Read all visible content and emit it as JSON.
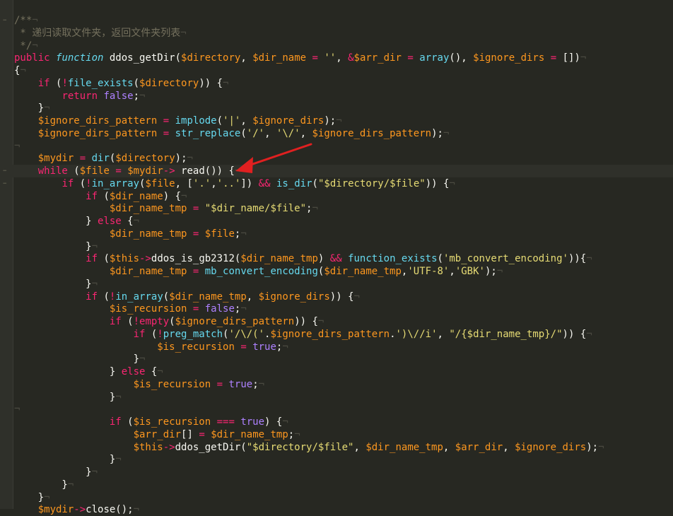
{
  "editor": {
    "theme_colors": {
      "background": "#272822",
      "comment": "#75715e",
      "keyword": "#f92672",
      "function": "#a6e22e",
      "builtin": "#66d9ef",
      "variable": "#fd971f",
      "string": "#e6db74",
      "constant": "#ae81ff",
      "arrow_annotation": "#e02020"
    },
    "lines": [
      {
        "t": [
          [
            "cm",
            "/**"
          ]
        ]
      },
      {
        "t": [
          [
            "cm",
            " * 递归读取文件夹，返回文件夹列表"
          ]
        ]
      },
      {
        "t": [
          [
            "cm",
            " */"
          ]
        ]
      },
      {
        "t": [
          [
            "kw",
            "public"
          ],
          [
            "tx",
            " "
          ],
          [
            "st",
            "function"
          ],
          [
            "tx",
            " ddos_getDir("
          ],
          [
            "vr",
            "$directory"
          ],
          [
            "tx",
            ", "
          ],
          [
            "vr",
            "$dir_name"
          ],
          [
            "tx",
            " "
          ],
          [
            "op",
            "="
          ],
          [
            "tx",
            " "
          ],
          [
            "str",
            "''"
          ],
          [
            "tx",
            ", "
          ],
          [
            "op",
            "&"
          ],
          [
            "vr",
            "$arr_dir"
          ],
          [
            "tx",
            " "
          ],
          [
            "op",
            "="
          ],
          [
            "tx",
            " "
          ],
          [
            "bi",
            "array"
          ],
          [
            "tx",
            "(), "
          ],
          [
            "vr",
            "$ignore_dirs"
          ],
          [
            "tx",
            " "
          ],
          [
            "op",
            "="
          ],
          [
            "tx",
            " [])"
          ]
        ]
      },
      {
        "t": [
          [
            "tx",
            "{"
          ]
        ]
      },
      {
        "t": [
          [
            "tx",
            "    "
          ],
          [
            "kw",
            "if"
          ],
          [
            "tx",
            " ("
          ],
          [
            "op",
            "!"
          ],
          [
            "bi",
            "file_exists"
          ],
          [
            "tx",
            "("
          ],
          [
            "vr",
            "$directory"
          ],
          [
            "tx",
            ")) {"
          ]
        ]
      },
      {
        "t": [
          [
            "tx",
            "        "
          ],
          [
            "kw",
            "return"
          ],
          [
            "tx",
            " "
          ],
          [
            "cn",
            "false"
          ],
          [
            "tx",
            ";"
          ]
        ]
      },
      {
        "t": [
          [
            "tx",
            "    }"
          ]
        ]
      },
      {
        "t": [
          [
            "tx",
            "    "
          ],
          [
            "vr",
            "$ignore_dirs_pattern"
          ],
          [
            "tx",
            " "
          ],
          [
            "op",
            "="
          ],
          [
            "tx",
            " "
          ],
          [
            "bi",
            "implode"
          ],
          [
            "tx",
            "("
          ],
          [
            "str",
            "'|'"
          ],
          [
            "tx",
            ", "
          ],
          [
            "vr",
            "$ignore_dirs"
          ],
          [
            "tx",
            ");"
          ]
        ]
      },
      {
        "t": [
          [
            "tx",
            "    "
          ],
          [
            "vr",
            "$ignore_dirs_pattern"
          ],
          [
            "tx",
            " "
          ],
          [
            "op",
            "="
          ],
          [
            "tx",
            " "
          ],
          [
            "bi",
            "str_replace"
          ],
          [
            "tx",
            "("
          ],
          [
            "str",
            "'/'"
          ],
          [
            "tx",
            ", "
          ],
          [
            "str",
            "'\\/'"
          ],
          [
            "tx",
            ", "
          ],
          [
            "vr",
            "$ignore_dirs_pattern"
          ],
          [
            "tx",
            ");"
          ]
        ]
      },
      {
        "t": []
      },
      {
        "t": [
          [
            "tx",
            "    "
          ],
          [
            "vr",
            "$mydir"
          ],
          [
            "tx",
            " "
          ],
          [
            "op",
            "="
          ],
          [
            "tx",
            " "
          ],
          [
            "bi",
            "dir"
          ],
          [
            "tx",
            "("
          ],
          [
            "vr",
            "$directory"
          ],
          [
            "tx",
            ");"
          ]
        ]
      },
      {
        "t": [
          [
            "tx",
            "    "
          ],
          [
            "kw",
            "while"
          ],
          [
            "tx",
            " ("
          ],
          [
            "vr",
            "$file"
          ],
          [
            "tx",
            " "
          ],
          [
            "op",
            "="
          ],
          [
            "tx",
            " "
          ],
          [
            "vr",
            "$mydir"
          ],
          [
            "op",
            "->"
          ],
          [
            "tx",
            " read()) {"
          ]
        ],
        "current": true
      },
      {
        "t": [
          [
            "tx",
            "        "
          ],
          [
            "kw",
            "if"
          ],
          [
            "tx",
            " ("
          ],
          [
            "op",
            "!"
          ],
          [
            "bi",
            "in_array"
          ],
          [
            "tx",
            "("
          ],
          [
            "vr",
            "$file"
          ],
          [
            "tx",
            ", ["
          ],
          [
            "str",
            "'.'"
          ],
          [
            "tx",
            ","
          ],
          [
            "str",
            "'..'"
          ],
          [
            "tx",
            "]) "
          ],
          [
            "op",
            "&&"
          ],
          [
            "tx",
            " "
          ],
          [
            "bi",
            "is_dir"
          ],
          [
            "tx",
            "("
          ],
          [
            "str",
            "\"$directory/$file\""
          ],
          [
            "tx",
            ")) {"
          ]
        ]
      },
      {
        "t": [
          [
            "tx",
            "            "
          ],
          [
            "kw",
            "if"
          ],
          [
            "tx",
            " ("
          ],
          [
            "vr",
            "$dir_name"
          ],
          [
            "tx",
            ") {"
          ]
        ]
      },
      {
        "t": [
          [
            "tx",
            "                "
          ],
          [
            "vr",
            "$dir_name_tmp"
          ],
          [
            "tx",
            " "
          ],
          [
            "op",
            "="
          ],
          [
            "tx",
            " "
          ],
          [
            "str",
            "\"$dir_name/$file\""
          ],
          [
            "tx",
            ";"
          ]
        ]
      },
      {
        "t": [
          [
            "tx",
            "            } "
          ],
          [
            "kw",
            "else"
          ],
          [
            "tx",
            " {"
          ]
        ]
      },
      {
        "t": [
          [
            "tx",
            "                "
          ],
          [
            "vr",
            "$dir_name_tmp"
          ],
          [
            "tx",
            " "
          ],
          [
            "op",
            "="
          ],
          [
            "tx",
            " "
          ],
          [
            "vr",
            "$file"
          ],
          [
            "tx",
            ";"
          ]
        ]
      },
      {
        "t": [
          [
            "tx",
            "            }"
          ]
        ]
      },
      {
        "t": [
          [
            "tx",
            "            "
          ],
          [
            "kw",
            "if"
          ],
          [
            "tx",
            " ("
          ],
          [
            "vr",
            "$this"
          ],
          [
            "op",
            "->"
          ],
          [
            "tx",
            "ddos_is_gb2312("
          ],
          [
            "vr",
            "$dir_name_tmp"
          ],
          [
            "tx",
            ") "
          ],
          [
            "op",
            "&&"
          ],
          [
            "tx",
            " "
          ],
          [
            "bi",
            "function_exists"
          ],
          [
            "tx",
            "("
          ],
          [
            "str",
            "'mb_convert_encoding'"
          ],
          [
            "tx",
            ")){"
          ]
        ]
      },
      {
        "t": [
          [
            "tx",
            "                "
          ],
          [
            "vr",
            "$dir_name_tmp"
          ],
          [
            "tx",
            " "
          ],
          [
            "op",
            "="
          ],
          [
            "tx",
            " "
          ],
          [
            "bi",
            "mb_convert_encoding"
          ],
          [
            "tx",
            "("
          ],
          [
            "vr",
            "$dir_name_tmp"
          ],
          [
            "tx",
            ","
          ],
          [
            "str",
            "'UTF-8'"
          ],
          [
            "tx",
            ","
          ],
          [
            "str",
            "'GBK'"
          ],
          [
            "tx",
            ");"
          ]
        ]
      },
      {
        "t": [
          [
            "tx",
            "            }"
          ]
        ]
      },
      {
        "t": [
          [
            "tx",
            "            "
          ],
          [
            "kw",
            "if"
          ],
          [
            "tx",
            " ("
          ],
          [
            "op",
            "!"
          ],
          [
            "bi",
            "in_array"
          ],
          [
            "tx",
            "("
          ],
          [
            "vr",
            "$dir_name_tmp"
          ],
          [
            "tx",
            ", "
          ],
          [
            "vr",
            "$ignore_dirs"
          ],
          [
            "tx",
            ")) {"
          ]
        ]
      },
      {
        "t": [
          [
            "tx",
            "                "
          ],
          [
            "vr",
            "$is_recursion"
          ],
          [
            "tx",
            " "
          ],
          [
            "op",
            "="
          ],
          [
            "tx",
            " "
          ],
          [
            "cn",
            "false"
          ],
          [
            "tx",
            ";"
          ]
        ]
      },
      {
        "t": [
          [
            "tx",
            "                "
          ],
          [
            "kw",
            "if"
          ],
          [
            "tx",
            " ("
          ],
          [
            "op",
            "!"
          ],
          [
            "kw",
            "empty"
          ],
          [
            "tx",
            "("
          ],
          [
            "vr",
            "$ignore_dirs_pattern"
          ],
          [
            "tx",
            ")) {"
          ]
        ]
      },
      {
        "t": [
          [
            "tx",
            "                    "
          ],
          [
            "kw",
            "if"
          ],
          [
            "tx",
            " ("
          ],
          [
            "op",
            "!"
          ],
          [
            "bi",
            "preg_match"
          ],
          [
            "tx",
            "("
          ],
          [
            "str",
            "'/\\/('"
          ],
          [
            "tx",
            "."
          ],
          [
            "vr",
            "$ignore_dirs_pattern"
          ],
          [
            "tx",
            "."
          ],
          [
            "str",
            "')\\//i'"
          ],
          [
            "tx",
            ", "
          ],
          [
            "str",
            "\"/{$dir_name_tmp}/\""
          ],
          [
            "tx",
            ")) {"
          ]
        ]
      },
      {
        "t": [
          [
            "tx",
            "                        "
          ],
          [
            "vr",
            "$is_recursion"
          ],
          [
            "tx",
            " "
          ],
          [
            "op",
            "="
          ],
          [
            "tx",
            " "
          ],
          [
            "cn",
            "true"
          ],
          [
            "tx",
            ";"
          ]
        ]
      },
      {
        "t": [
          [
            "tx",
            "                    }"
          ]
        ]
      },
      {
        "t": [
          [
            "tx",
            "                } "
          ],
          [
            "kw",
            "else"
          ],
          [
            "tx",
            " {"
          ]
        ]
      },
      {
        "t": [
          [
            "tx",
            "                    "
          ],
          [
            "vr",
            "$is_recursion"
          ],
          [
            "tx",
            " "
          ],
          [
            "op",
            "="
          ],
          [
            "tx",
            " "
          ],
          [
            "cn",
            "true"
          ],
          [
            "tx",
            ";"
          ]
        ]
      },
      {
        "t": [
          [
            "tx",
            "                }"
          ]
        ]
      },
      {
        "t": []
      },
      {
        "t": [
          [
            "tx",
            "                "
          ],
          [
            "kw",
            "if"
          ],
          [
            "tx",
            " ("
          ],
          [
            "vr",
            "$is_recursion"
          ],
          [
            "tx",
            " "
          ],
          [
            "op",
            "==="
          ],
          [
            "tx",
            " "
          ],
          [
            "cn",
            "true"
          ],
          [
            "tx",
            ") {"
          ]
        ]
      },
      {
        "t": [
          [
            "tx",
            "                    "
          ],
          [
            "vr",
            "$arr_dir"
          ],
          [
            "tx",
            "[] "
          ],
          [
            "op",
            "="
          ],
          [
            "tx",
            " "
          ],
          [
            "vr",
            "$dir_name_tmp"
          ],
          [
            "tx",
            ";"
          ]
        ]
      },
      {
        "t": [
          [
            "tx",
            "                    "
          ],
          [
            "vr",
            "$this"
          ],
          [
            "op",
            "->"
          ],
          [
            "tx",
            "ddos_getDir("
          ],
          [
            "str",
            "\"$directory/$file\""
          ],
          [
            "tx",
            ", "
          ],
          [
            "vr",
            "$dir_name_tmp"
          ],
          [
            "tx",
            ", "
          ],
          [
            "vr",
            "$arr_dir"
          ],
          [
            "tx",
            ", "
          ],
          [
            "vr",
            "$ignore_dirs"
          ],
          [
            "tx",
            ");"
          ]
        ]
      },
      {
        "t": [
          [
            "tx",
            "                }"
          ]
        ]
      },
      {
        "t": [
          [
            "tx",
            "            }"
          ]
        ]
      },
      {
        "t": [
          [
            "tx",
            "        }"
          ]
        ]
      },
      {
        "t": [
          [
            "tx",
            "    }"
          ]
        ]
      },
      {
        "t": [
          [
            "tx",
            "    "
          ],
          [
            "vr",
            "$mydir"
          ],
          [
            "op",
            "->"
          ],
          [
            "tx",
            "close();"
          ]
        ]
      }
    ]
  }
}
